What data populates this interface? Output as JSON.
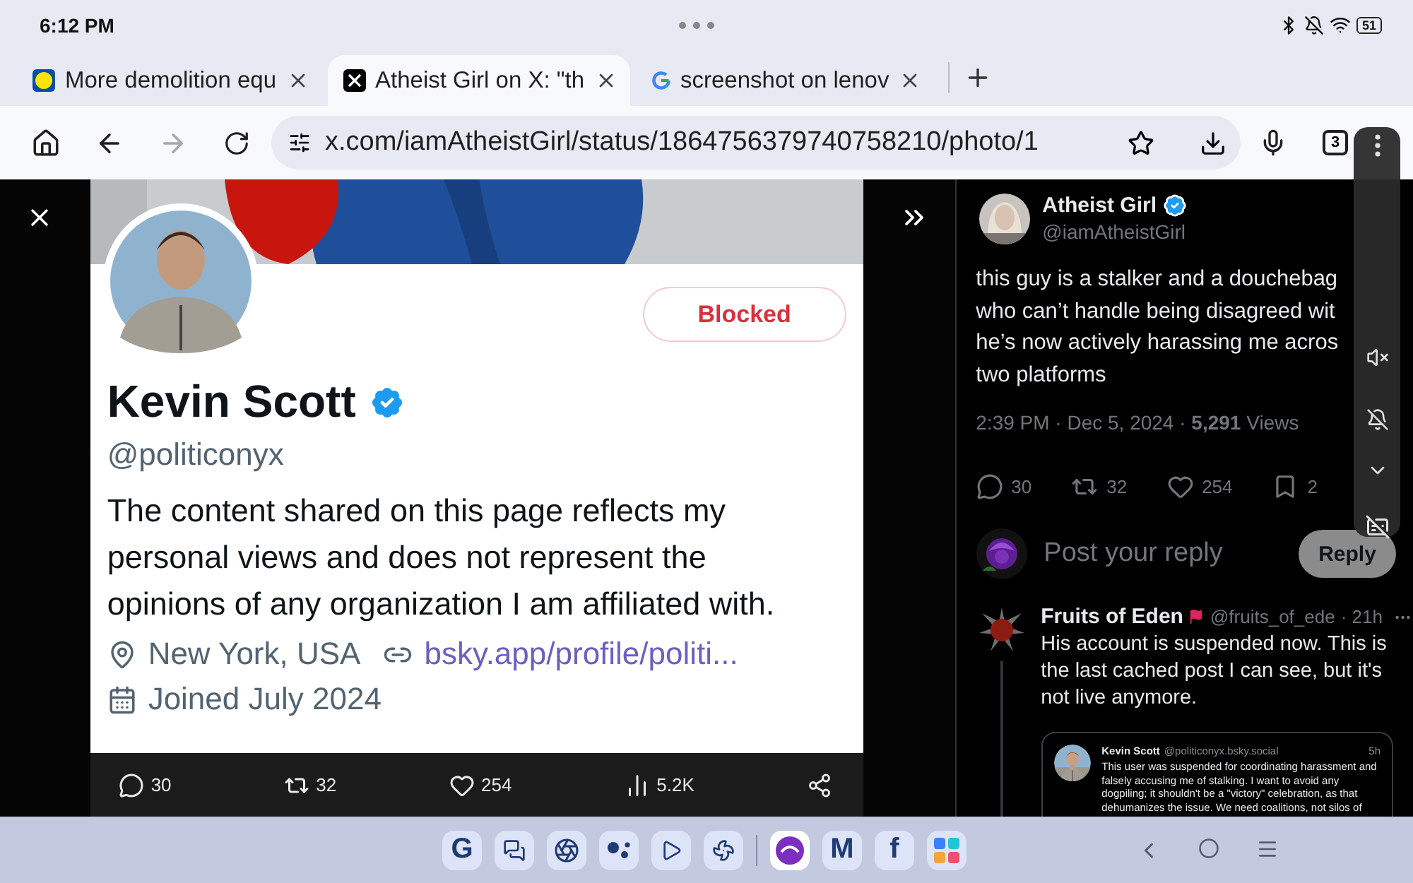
{
  "status_bar": {
    "time": "6:12 PM",
    "battery": "51"
  },
  "tabs": [
    {
      "title": "More demolition equ",
      "kind": "store",
      "selected": false
    },
    {
      "title": "Atheist Girl on X: \"th",
      "kind": "x",
      "selected": true
    },
    {
      "title": "screenshot on lenov",
      "kind": "google",
      "selected": false
    }
  ],
  "toolbar": {
    "url": "x.com/iamAtheistGirl/status/1864756379740758210/photo/1",
    "forward_disabled": true,
    "tab_count": "3"
  },
  "photo": {
    "profile": {
      "name": "Kevin Scott",
      "handle": "@politiconyx",
      "button": "Blocked",
      "bio": "The content shared on this page reflects my personal views and does not represent the opinions of any organization I am affiliated with.",
      "location": "New York, USA",
      "link": "bsky.app/profile/politi...",
      "joined": "Joined July 2024"
    },
    "actions": [
      {
        "kind": "reply",
        "count": "30"
      },
      {
        "kind": "repost",
        "count": "32"
      },
      {
        "kind": "like",
        "count": "254"
      },
      {
        "kind": "views",
        "count": "5.2K"
      },
      {
        "kind": "share"
      }
    ]
  },
  "tweet": {
    "name": "Atheist Girl",
    "handle": "@iamAtheistGirl",
    "text_lines": [
      "this guy is a stalker and a douchebag",
      "who can’t handle being disagreed wit",
      "he’s now actively harassing me acros",
      "two platforms"
    ],
    "meta": "2:39 PM · Dec 5, 2024 · **5,291** Views",
    "actions": [
      {
        "kind": "reply",
        "count": "30"
      },
      {
        "kind": "repost",
        "count": "32"
      },
      {
        "kind": "like",
        "count": "254"
      },
      {
        "kind": "bookmark",
        "count": "2"
      }
    ]
  },
  "reply_box": {
    "placeholder": "Post your reply",
    "button": "Reply",
    "disabled": true
  },
  "reply": {
    "name": "Fruits of Eden",
    "handle": "@fruits_of_ede",
    "time": "· 21h",
    "text": "His account is suspended now. This is the last cached post I can see, but it's not live anymore.",
    "quote": {
      "name": "Kevin Scott",
      "handle": "@politiconyx.bsky.social",
      "time": "5h",
      "text": "This user was suspended for coordinating harassment and falsely accusing me of stalking. I want to avoid any dogpiling; it shouldn't be a \"victory\" celebration, as that dehumanizes the issue. We need coalitions, not silos of"
    }
  },
  "dock": [
    {
      "kind": "letter",
      "glyph": "G"
    },
    {
      "kind": "chat"
    },
    {
      "kind": "browser"
    },
    {
      "kind": "assistant"
    },
    {
      "kind": "play"
    },
    {
      "kind": "pinwheel"
    },
    {
      "kind": "divider"
    },
    {
      "kind": "purple"
    },
    {
      "kind": "letter",
      "glyph": "M"
    },
    {
      "kind": "letter",
      "glyph": "f"
    },
    {
      "kind": "grid"
    }
  ]
}
